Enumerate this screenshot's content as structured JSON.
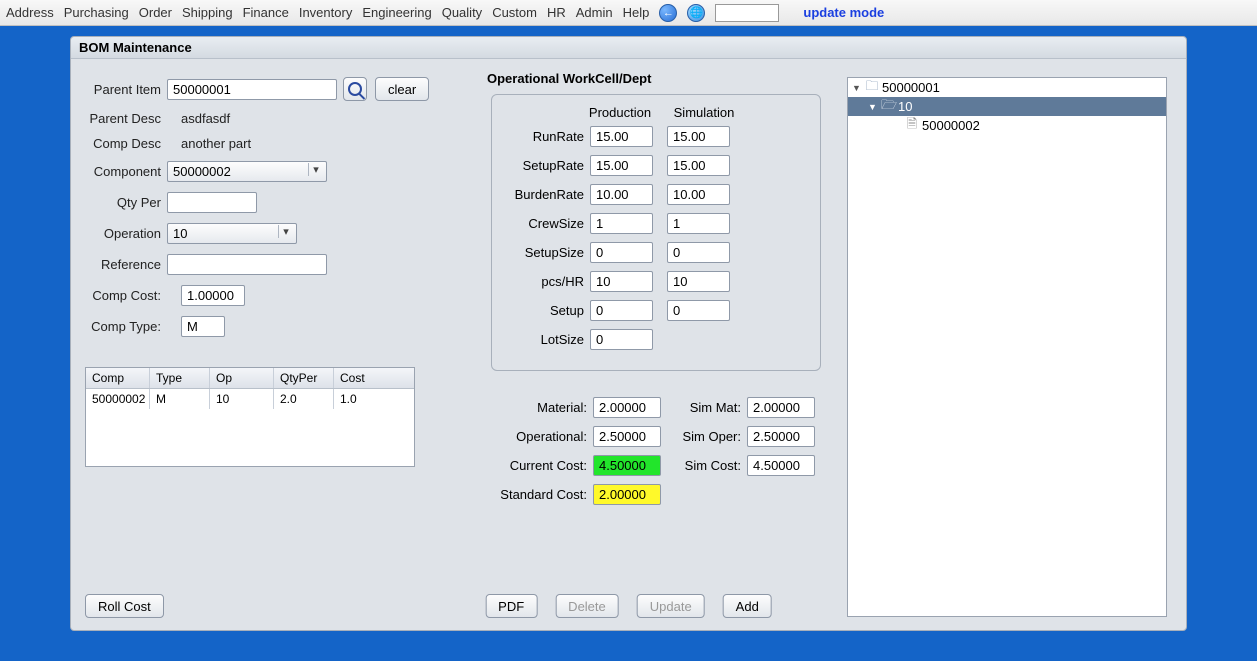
{
  "menu": [
    "Address",
    "Purchasing",
    "Order",
    "Shipping",
    "Finance",
    "Inventory",
    "Engineering",
    "Quality",
    "Custom",
    "HR",
    "Admin",
    "Help"
  ],
  "quick_search": "",
  "mode_label": "update mode",
  "panel_title": "BOM Maintenance",
  "form": {
    "parent_item_label": "Parent Item",
    "parent_item": "50000001",
    "clear_btn": "clear",
    "parent_desc_label": "Parent Desc",
    "parent_desc": "asdfasdf",
    "comp_desc_label": "Comp Desc",
    "comp_desc": "another part",
    "component_label": "Component",
    "component": "50000002",
    "qty_per_label": "Qty Per",
    "qty_per": "",
    "operation_label": "Operation",
    "operation": "10",
    "reference_label": "Reference",
    "reference": "",
    "comp_cost_label": "Comp Cost:",
    "comp_cost": "1.00000",
    "comp_type_label": "Comp Type:",
    "comp_type": "M"
  },
  "comp_table": {
    "headers": {
      "comp": "Comp",
      "type": "Type",
      "op": "Op",
      "qtyper": "QtyPer",
      "cost": "Cost"
    },
    "rows": [
      {
        "comp": "50000002",
        "type": "M",
        "op": "10",
        "qtyper": "2.0",
        "cost": "1.0"
      }
    ]
  },
  "workcell": {
    "legend": "Operational WorkCell/Dept",
    "col1": "Production",
    "col2": "Simulation",
    "runrate_label": "RunRate",
    "runrate_p": "15.00",
    "runrate_s": "15.00",
    "setuprate_label": "SetupRate",
    "setuprate_p": "15.00",
    "setuprate_s": "15.00",
    "burden_label": "BurdenRate",
    "burden_p": "10.00",
    "burden_s": "10.00",
    "crew_label": "CrewSize",
    "crew_p": "1",
    "crew_s": "1",
    "setupsize_label": "SetupSize",
    "setupsize_p": "0",
    "setupsize_s": "0",
    "pcshr_label": "pcs/HR",
    "pcshr_p": "10",
    "pcshr_s": "10",
    "setup_label": "Setup",
    "setup_p": "0",
    "setup_s": "0",
    "lotsize_label": "LotSize",
    "lotsize_p": "0"
  },
  "costs": {
    "material_label": "Material:",
    "material": "2.00000",
    "simmat_label": "Sim Mat:",
    "simmat": "2.00000",
    "oper_label": "Operational:",
    "oper": "2.50000",
    "simoper_label": "Sim Oper:",
    "simoper": "2.50000",
    "current_label": "Current Cost:",
    "current": "4.50000",
    "simcost_label": "Sim Cost:",
    "simcost": "4.50000",
    "standard_label": "Standard Cost:",
    "standard": "2.00000"
  },
  "tree": {
    "root": "50000001",
    "node1": "10",
    "leaf1": "50000002"
  },
  "buttons": {
    "roll": "Roll Cost",
    "pdf": "PDF",
    "delete": "Delete",
    "update": "Update",
    "add": "Add"
  }
}
